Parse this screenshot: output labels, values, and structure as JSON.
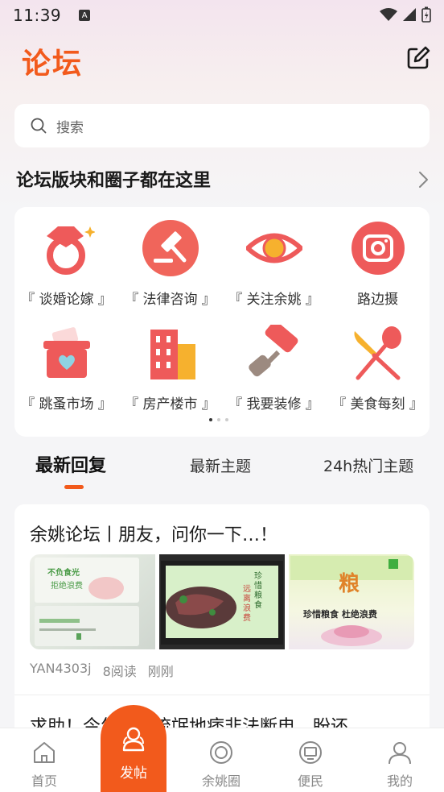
{
  "status_bar": {
    "time": "11:39",
    "notification_icon": "A"
  },
  "header": {
    "title": "论坛"
  },
  "search": {
    "placeholder": "搜索"
  },
  "section": {
    "title": "论坛版块和圈子都在这里"
  },
  "categories": [
    {
      "label": "『 谈婚论嫁 』",
      "icon": "ring-icon"
    },
    {
      "label": "『 法律咨询 』",
      "icon": "gavel-icon"
    },
    {
      "label": "『 关注余姚 』",
      "icon": "eye-icon"
    },
    {
      "label": "路边摄",
      "icon": "camera-icon"
    },
    {
      "label": "『 跳蚤市场 』",
      "icon": "gift-basket-icon"
    },
    {
      "label": "『 房产楼市 』",
      "icon": "building-icon"
    },
    {
      "label": "『 我要装修 』",
      "icon": "paint-roller-icon"
    },
    {
      "label": "『 美食每刻 』",
      "icon": "knife-spoon-icon"
    }
  ],
  "tabs": [
    {
      "label": "最新回复",
      "active": true
    },
    {
      "label": "最新主题",
      "active": false
    },
    {
      "label": "24h热门主题",
      "active": false
    }
  ],
  "posts": [
    {
      "title": "余姚论坛丨朋友，问你一下…！",
      "author": "YAN4303j",
      "reads": "8阅读",
      "time": "刚刚",
      "images": [
        {
          "text1": "不负食光",
          "text2": "拒绝浪费"
        },
        {
          "text1": "珍惜粮食",
          "text2": "远离浪费"
        },
        {
          "text1": "粮",
          "text2": "珍惜粮食 杜绝浪费"
        }
      ]
    },
    {
      "title": "求助！今年遭遇流氓地痞非法断电，盼还"
    }
  ],
  "bottom_nav": {
    "home": "首页",
    "post": "发帖",
    "circle": "余姚圈",
    "service": "便民",
    "mine": "我的"
  },
  "colors": {
    "accent": "#f25a1c",
    "icon_red": "#ee5a5a"
  }
}
